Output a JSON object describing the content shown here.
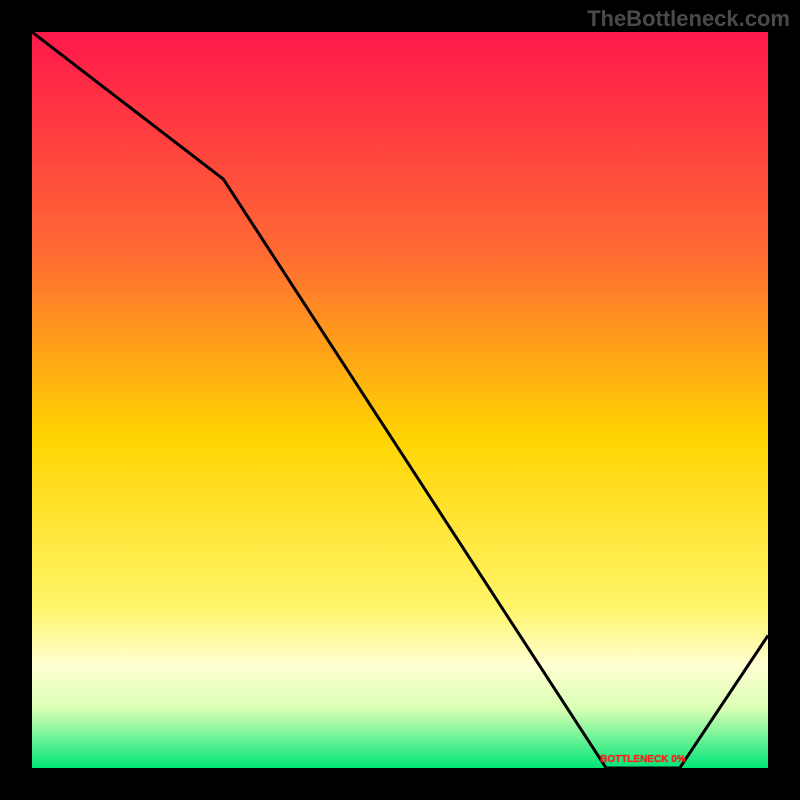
{
  "watermark": "TheBottleneck.com",
  "bottom_label": "BOTTLENECK 0%",
  "chart_data": {
    "type": "line",
    "title": "",
    "xlabel": "",
    "ylabel": "",
    "x": [
      0.0,
      0.26,
      0.78,
      0.88,
      1.0
    ],
    "values": [
      1.0,
      0.8,
      0.0,
      0.0,
      0.18
    ],
    "xlim": [
      0,
      1
    ],
    "ylim": [
      0,
      1
    ],
    "annotations": [
      {
        "text": "BOTTLENECK 0%",
        "x": 0.83,
        "y": 0.0
      }
    ],
    "background_gradient_stops": [
      {
        "pos": 0.0,
        "color": "#ff184b"
      },
      {
        "pos": 0.3,
        "color": "#ff6a33"
      },
      {
        "pos": 0.55,
        "color": "#ffd400"
      },
      {
        "pos": 0.78,
        "color": "#fff568"
      },
      {
        "pos": 0.86,
        "color": "#ffffd2"
      },
      {
        "pos": 0.92,
        "color": "#d8ffb4"
      },
      {
        "pos": 1.0,
        "color": "#00e678"
      }
    ]
  }
}
